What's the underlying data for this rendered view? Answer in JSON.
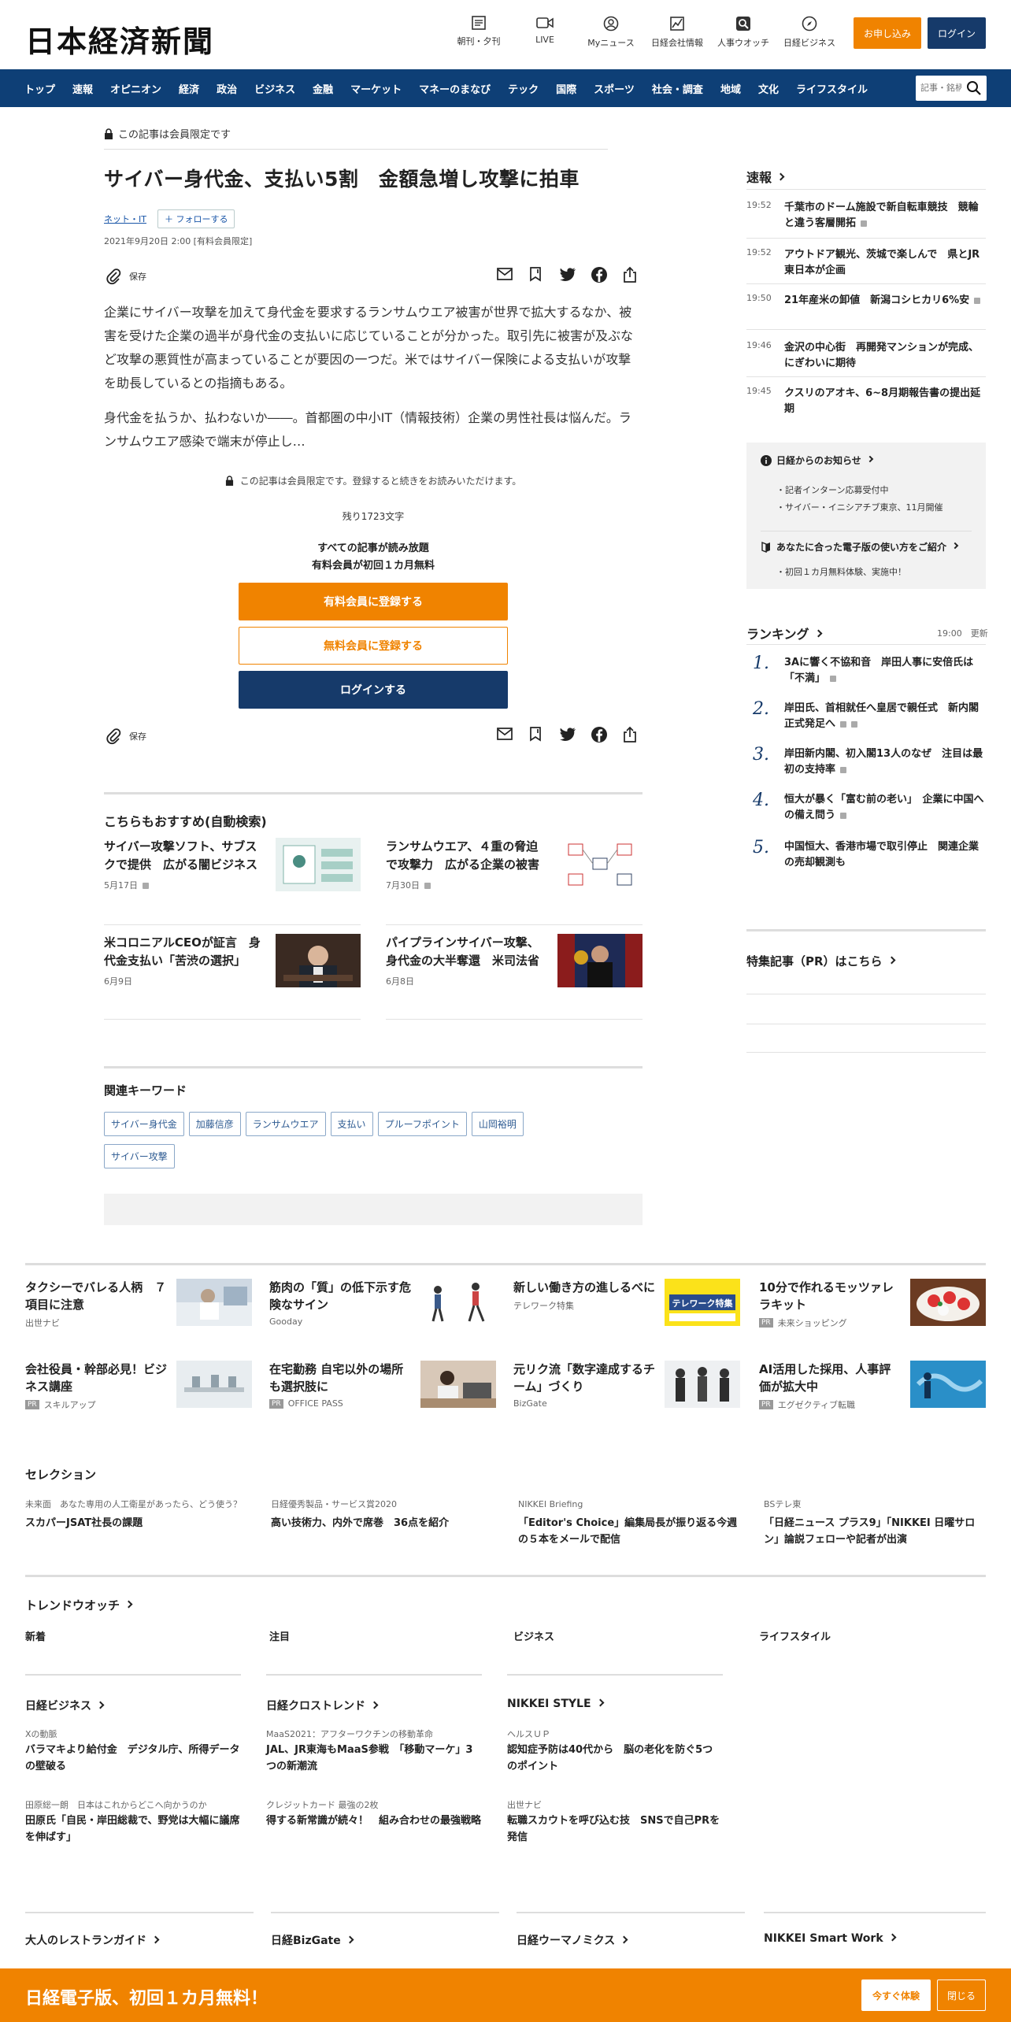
{
  "header": {
    "logo": "日本経済新聞",
    "icons": [
      {
        "label": "朝刊・夕刊",
        "icon": "newspaper-icon"
      },
      {
        "label": "LIVE",
        "icon": "video-icon"
      },
      {
        "label": "Myニュース",
        "icon": "user-icon"
      },
      {
        "label": "日経会社情報",
        "icon": "chart-icon"
      },
      {
        "label": "人事ウオッチ",
        "icon": "search-person-icon"
      },
      {
        "label": "日経ビジネス",
        "icon": "compass-icon"
      }
    ],
    "subscribe": "お申し込み",
    "login": "ログイン"
  },
  "nav": {
    "items": [
      "トップ",
      "速報",
      "オピニオン",
      "経済",
      "政治",
      "ビジネス",
      "金融",
      "マーケット",
      "マネーのまなび",
      "テック",
      "国際",
      "スポーツ",
      "社会・調査",
      "地域",
      "文化",
      "ライフスタイル"
    ],
    "search_placeholder": "記事・銘柄"
  },
  "article": {
    "member_only": "この記事は会員限定です",
    "title": "サイバー身代金、支払い5割　金額急増し攻撃に拍車",
    "topic": "ネット・IT",
    "follow": "フォローする",
    "date": "2021年9月20日 2:00 [有料会員限定]",
    "save": "保存",
    "p1": "企業にサイバー攻撃を加えて身代金を要求するランサムウエア被害が世界で拡大するなか、被害を受けた企業の過半が身代金の支払いに応じていることが分かった。取引先に被害が及ぶなど攻撃の悪質性が高まっていることが要因の一つだ。米ではサイバー保険による支払いが攻撃を助長しているとの指摘もある。",
    "p2": "身代金を払うか、払わないか――。首都圏の中小IT（情報技術）企業の男性社長は悩んだ。ランサムウエア感染で端末が停止し…",
    "paywall_note": "この記事は会員限定です。登録すると続きをお読みいただけます。",
    "remaining": "残り1723文字",
    "read_all_1": "すべての記事が読み放題",
    "read_all_2": "有料会員が初回１カ月無料",
    "cta_paid": "有料会員に登録する",
    "cta_free": "無料会員に登録する",
    "cta_login": "ログインする"
  },
  "recommend": {
    "title": "こちらもおすすめ(自動検索)",
    "items": [
      {
        "title": "サイバー攻撃ソフト、サブスクで提供　広がる闇ビジネス",
        "date": "5月17日"
      },
      {
        "title": "ランサムウエア、４重の脅迫で攻撃力　広がる企業の被害",
        "date": "7月30日"
      },
      {
        "title": "米コロニアルCEOが証言　身代金支払い「苦渋の選択」",
        "date": "6月9日"
      },
      {
        "title": "パイプラインサイバー攻撃、身代金の大半奪還　米司法省",
        "date": "6月8日"
      }
    ]
  },
  "keywords": {
    "title": "関連キーワード",
    "items": [
      "サイバー身代金",
      "加藤信彦",
      "ランサムウエア",
      "支払い",
      "プルーフポイント",
      "山岡裕明",
      "サイバー攻撃"
    ]
  },
  "sidebar": {
    "news_title": "速報",
    "news": [
      {
        "time": "19:52",
        "text": "千葉市のドーム施設で新自転車競技　競輪と違う客層開拓"
      },
      {
        "time": "19:52",
        "text": "アウトドア観光、茨城で楽しんで　県とJR東日本が企画"
      },
      {
        "time": "19:50",
        "text": "21年産米の卸値　新潟コシヒカリ6%安"
      },
      {
        "time": "19:46",
        "text": "金沢の中心街　再開発マンションが完成、にぎわいに期待"
      },
      {
        "time": "19:45",
        "text": "クスリのアオキ、6~8月期報告書の提出延期"
      }
    ],
    "notice_title": "日経からのお知らせ",
    "notices": [
      "記者インターン応募受付中",
      "サイバー・イニシアチブ東京、11月開催"
    ],
    "guide_title": "あなたに合った電子版の使い方をご紹介",
    "guides": [
      "初回１カ月無料体験、実施中！"
    ],
    "ranking_title": "ランキング",
    "ranking_time": "19:00",
    "ranking_update": "更新",
    "ranking": [
      {
        "n": "1.",
        "text": "3Aに響く不協和音　岸田人事に安倍氏は「不満」"
      },
      {
        "n": "2.",
        "text": "岸田氏、首相就任へ皇居で親任式　新内閣正式発足へ"
      },
      {
        "n": "3.",
        "text": "岸田新内閣、初入閣13人のなぜ　注目は最初の支持率"
      },
      {
        "n": "4.",
        "text": "恒大が暴く「富む前の老い」　企業に中国への備え問う"
      },
      {
        "n": "5.",
        "text": "中国恒大、香港市場で取引停止　関連企業の売却観測も"
      }
    ],
    "pr_title": "特集記事（PR）はこちら"
  },
  "ads": [
    {
      "title": "タクシーでバレる人柄　７項目に注意",
      "source": "出世ナビ",
      "pr": false
    },
    {
      "title": "筋肉の「質」の低下示す危険なサイン",
      "source": "Gooday",
      "pr": false
    },
    {
      "title": "新しい働き方の進しるべに",
      "source": "テレワーク特集",
      "pr": false
    },
    {
      "title": "10分で作れるモッツァレラキット",
      "source": "未来ショッピング",
      "pr": true
    },
    {
      "title": "会社役員・幹部必見！ビジネス講座",
      "source": "スキルアップ",
      "pr": true
    },
    {
      "title": "在宅勤務 自宅以外の場所も選択肢に",
      "source": "OFFICE PASS",
      "pr": true
    },
    {
      "title": "元リク流「数字達成するチーム」づくり",
      "source": "BizGate",
      "pr": false
    },
    {
      "title": "AI活用した採用、人事評価が拡大中",
      "source": "エグゼクティブ転職",
      "pr": true
    }
  ],
  "pr_label": "PR",
  "telework_banner": "テレワーク特集",
  "selection": {
    "title": "セレクション",
    "items": [
      {
        "kicker": "未来面　あなた専用の人工衛星があったら、どう使う？",
        "title": "スカパーJSAT社長の課題"
      },
      {
        "kicker": "日経優秀製品・サービス賞2020",
        "title": "高い技術力、内外で席巻　36点を紹介"
      },
      {
        "kicker": "NIKKEI Briefing",
        "title": "「Editor's Choice」編集局長が振り返る今週の５本をメールで配信"
      },
      {
        "kicker": "BSテレ東",
        "title": "「日経ニュース プラス9」「NIKKEI 日曜サロン」論説フェローや記者が出演"
      }
    ]
  },
  "trend": {
    "title": "トレンドウオッチ",
    "cols": [
      "新着",
      "注目",
      "ビジネス",
      "ライフスタイル"
    ]
  },
  "brands": {
    "cols": [
      {
        "title": "日経ビジネス",
        "items": [
          {
            "kicker": "Xの動脈",
            "title": "バラマキより給付金　デジタル庁、所得データの壁破る"
          },
          {
            "kicker": "田原総一朗　日本はこれからどこへ向かうのか",
            "title": "田原氏「自民・岸田総裁で、野党は大幅に議席を伸ばす」"
          }
        ]
      },
      {
        "title": "日経クロストレンド",
        "items": [
          {
            "kicker": "MaaS2021：アフターワクチンの移動革命",
            "title": "JAL、JR東海もMaaS参戦　「移動マーケ」3つの新潮流"
          },
          {
            "kicker": "クレジットカード 最強の2枚",
            "title": "得する新常識が続々！　組み合わせの最強戦略"
          }
        ]
      },
      {
        "title": "NIKKEI STYLE",
        "items": [
          {
            "kicker": "ヘルスＵＰ",
            "title": "認知症予防は40代から　脳の老化を防ぐ5つのポイント"
          },
          {
            "kicker": "出世ナビ",
            "title": "転職スカウトを呼び込む技　SNSで自己PRを発信"
          }
        ]
      }
    ]
  },
  "more_brands": [
    "大人のレストランガイド",
    "日経BizGate",
    "日経ウーマノミクス",
    "NIKKEI Smart Work"
  ],
  "banner": {
    "text": "日経電子版、初回１カ月無料！",
    "try": "今すぐ体験",
    "close": "閉じる"
  },
  "colors": {
    "brand_navy": "#0e3f76",
    "accent_orange": "#f08300"
  }
}
